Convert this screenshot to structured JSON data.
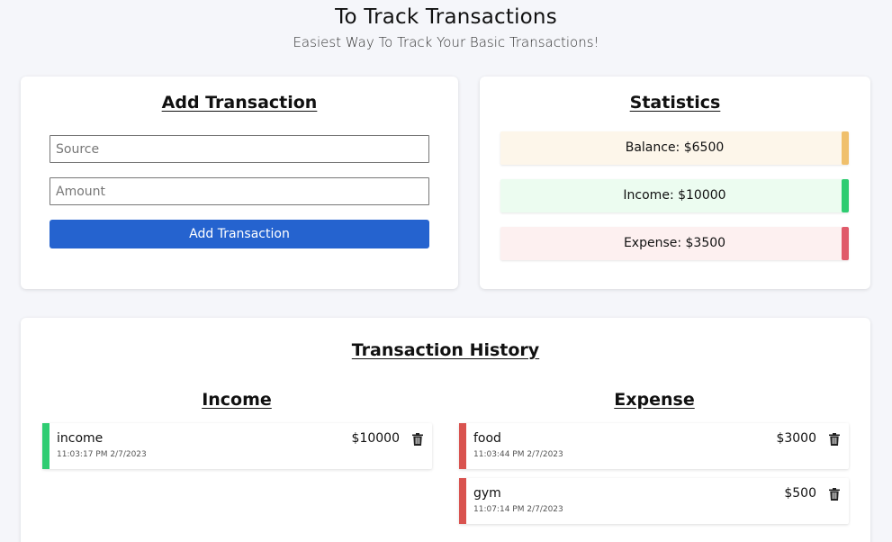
{
  "header": {
    "title": "To Track Transactions",
    "subtitle": "Easiest Way To Track Your Basic Transactions!"
  },
  "add_transaction": {
    "title": "Add Transaction",
    "source_placeholder": "Source",
    "amount_placeholder": "Amount",
    "button_label": "Add Transaction"
  },
  "statistics": {
    "title": "Statistics",
    "balance": "Balance: $6500",
    "income": "Income: $10000",
    "expense": "Expense: $3500",
    "colors": {
      "balance_accent": "#f0c06c",
      "income_accent": "#2ecc71",
      "expense_accent": "#e05a6a"
    }
  },
  "history": {
    "title": "Transaction History",
    "income_title": "Income",
    "expense_title": "Expense",
    "income_items": [
      {
        "name": "income",
        "time": "11:03:17 PM 2/7/2023",
        "amount": "$10000",
        "icon": "trash-icon"
      }
    ],
    "expense_items": [
      {
        "name": "food",
        "time": "11:03:44 PM 2/7/2023",
        "amount": "$3000",
        "icon": "trash-icon"
      },
      {
        "name": "gym",
        "time": "11:07:14 PM 2/7/2023",
        "amount": "$500",
        "icon": "trash-icon"
      }
    ],
    "colors": {
      "income_accent": "#2ecc71",
      "expense_accent": "#d9534f"
    }
  }
}
